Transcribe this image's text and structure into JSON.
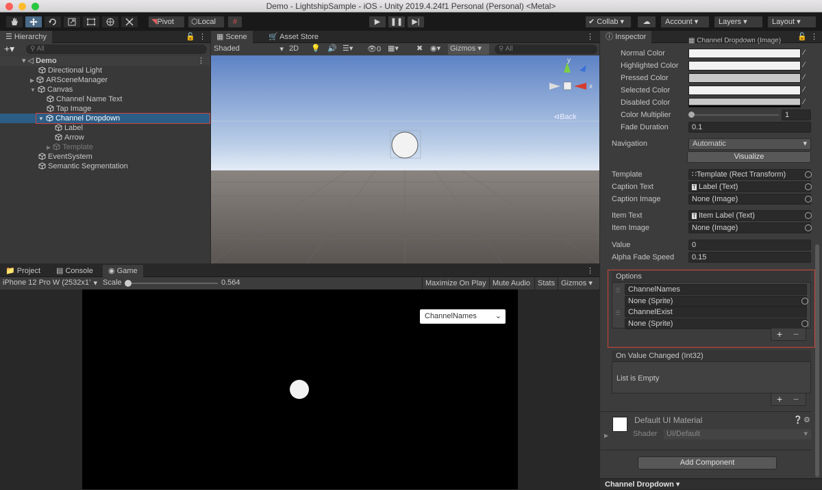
{
  "window": {
    "title": "Demo - LightshipSample - iOS - Unity 2019.4.24f1 Personal (Personal) <Metal>"
  },
  "toolbar": {
    "pivot": "Pivot",
    "local": "Local",
    "collab": "Collab",
    "account": "Account",
    "layers": "Layers",
    "layout": "Layout"
  },
  "hierarchy": {
    "tab": "Hierarchy",
    "search_placeholder": "All",
    "scene": "Demo",
    "items": [
      {
        "label": "Directional Light"
      },
      {
        "label": "ARSceneManager"
      },
      {
        "label": "Canvas"
      },
      {
        "label": "Channel Name Text"
      },
      {
        "label": "Tap Image"
      },
      {
        "label": "Channel Dropdown"
      },
      {
        "label": "Label"
      },
      {
        "label": "Arrow"
      },
      {
        "label": "Template"
      },
      {
        "label": "EventSystem"
      },
      {
        "label": "Semantic Segmentation"
      }
    ]
  },
  "scene": {
    "tab": "Scene",
    "tab2": "Asset Store",
    "shading": "Shaded",
    "mode2d": "2D",
    "fx_count": "0",
    "gizmos": "Gizmos",
    "search_placeholder": "All",
    "axis_y": "y",
    "axis_x": "x",
    "back": "⊲Back"
  },
  "bottom": {
    "tabs": [
      "Project",
      "Console",
      "Game"
    ],
    "device": "iPhone 12 Pro W (2532x1’",
    "scale_label": "Scale",
    "scale_value": "0.564",
    "maximize": "Maximize On Play",
    "mute": "Mute Audio",
    "stats": "Stats",
    "gizmos": "Gizmos",
    "dropdown_value": "ChannelNames"
  },
  "inspector": {
    "tab": "Inspector",
    "target_graphic": "Channel Dropdown (Image)",
    "colors": [
      {
        "label": "Normal Color"
      },
      {
        "label": "Highlighted Color"
      },
      {
        "label": "Pressed Color"
      },
      {
        "label": "Selected Color"
      },
      {
        "label": "Disabled Color"
      }
    ],
    "color_multiplier_label": "Color Multiplier",
    "color_multiplier": "1",
    "fade_duration_label": "Fade Duration",
    "fade_duration": "0.1",
    "navigation_label": "Navigation",
    "navigation": "Automatic",
    "visualize": "Visualize",
    "template_label": "Template",
    "template": "Template (Rect Transform)",
    "caption_text_label": "Caption Text",
    "caption_text": "Label (Text)",
    "caption_image_label": "Caption Image",
    "caption_image": "None (Image)",
    "item_text_label": "Item Text",
    "item_text": "Item Label (Text)",
    "item_image_label": "Item Image",
    "item_image": "None (Image)",
    "value_label": "Value",
    "value": "0",
    "alpha_label": "Alpha Fade Speed",
    "alpha": "0.15",
    "options_label": "Options",
    "options": [
      {
        "text": "ChannelNames",
        "sprite": "None (Sprite)"
      },
      {
        "text": "ChannelExist",
        "sprite": "None (Sprite)"
      }
    ],
    "on_value_changed": "On Value Changed (Int32)",
    "list_empty": "List is Empty",
    "material_name": "Default UI Material",
    "shader_label": "Shader",
    "shader": "UI/Default",
    "add_component": "Add Component",
    "footer": "Channel Dropdown"
  }
}
